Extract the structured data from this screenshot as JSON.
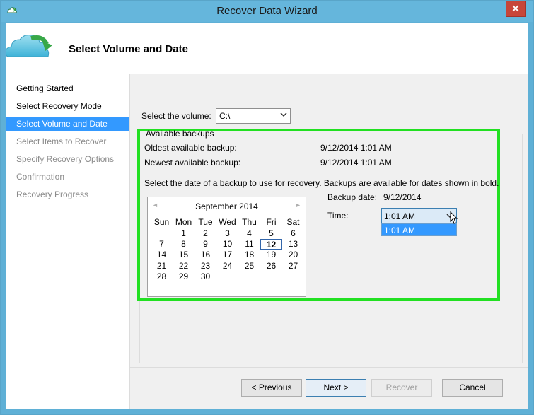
{
  "window": {
    "title": "Recover Data Wizard",
    "close_label": "✕"
  },
  "header": {
    "title": "Select Volume and Date"
  },
  "sidebar": {
    "items": [
      {
        "label": "Getting Started",
        "state": "normal"
      },
      {
        "label": "Select Recovery Mode",
        "state": "normal"
      },
      {
        "label": "Select Volume and Date",
        "state": "active"
      },
      {
        "label": "Select Items to Recover",
        "state": "disabled"
      },
      {
        "label": "Specify Recovery Options",
        "state": "disabled"
      },
      {
        "label": "Confirmation",
        "state": "disabled"
      },
      {
        "label": "Recovery Progress",
        "state": "disabled"
      }
    ]
  },
  "volume": {
    "label": "Select the volume:",
    "value": "C:\\"
  },
  "backups": {
    "group_label": "Available backups",
    "oldest_label": "Oldest available backup:",
    "oldest_value": "9/12/2014 1:01 AM",
    "newest_label": "Newest available backup:",
    "newest_value": "9/12/2014 1:01 AM",
    "instruction": "Select the date of a backup to use for recovery. Backups are available for dates shown in bold.",
    "backup_date_label": "Backup date:",
    "backup_date_value": "9/12/2014",
    "time_label": "Time:",
    "time_value": "1:01 AM",
    "time_options": [
      "1:01 AM"
    ]
  },
  "calendar": {
    "month": "September 2014",
    "prev": "◄",
    "next": "►",
    "weekdays": [
      "Sun",
      "Mon",
      "Tue",
      "Wed",
      "Thu",
      "Fri",
      "Sat"
    ],
    "weeks": [
      [
        "",
        "1",
        "2",
        "3",
        "4",
        "5",
        "6"
      ],
      [
        "7",
        "8",
        "9",
        "10",
        "11",
        "12",
        "13"
      ],
      [
        "14",
        "15",
        "16",
        "17",
        "18",
        "19",
        "20"
      ],
      [
        "21",
        "22",
        "23",
        "24",
        "25",
        "26",
        "27"
      ],
      [
        "28",
        "29",
        "30",
        "",
        "",
        "",
        ""
      ]
    ],
    "selected_day": "12"
  },
  "buttons": {
    "previous": "< Previous",
    "next": "Next >",
    "recover": "Recover",
    "cancel": "Cancel"
  },
  "colors": {
    "selection": "#3399ff",
    "highlight_box": "#22e022",
    "titlebar": "#65b6dc"
  }
}
